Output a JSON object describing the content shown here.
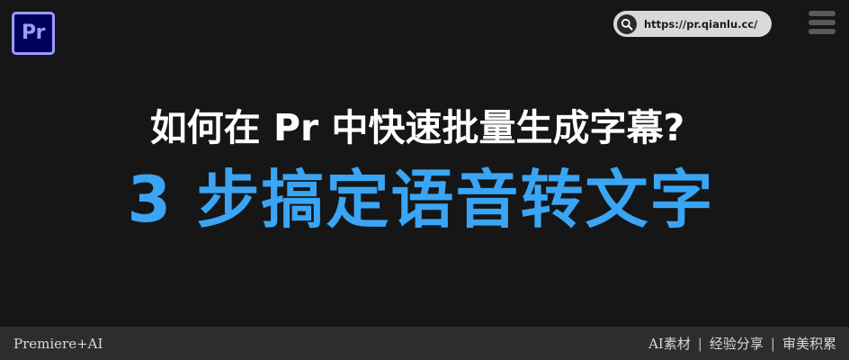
{
  "header": {
    "app_logo_text": "Pr",
    "url_text": "https://pr.qianlu.cc/"
  },
  "headline": {
    "line1": "如何在 Pr 中快速批量生成字幕?",
    "line2": "3 步搞定语音转文字"
  },
  "footer": {
    "left_label": "Premiere+AI",
    "tags": [
      "AI素材",
      "经验分享",
      "审美积累"
    ],
    "separator": "|"
  },
  "colors": {
    "background": "#161616",
    "headline_primary": "#ffffff",
    "headline_accent": "#3aa5f4",
    "footer_background": "#2d2d2d",
    "logo_fill": "#00005b",
    "logo_accent": "#9b9bff"
  },
  "icons": {
    "search": "search-icon",
    "menu": "hamburger-menu-icon"
  }
}
